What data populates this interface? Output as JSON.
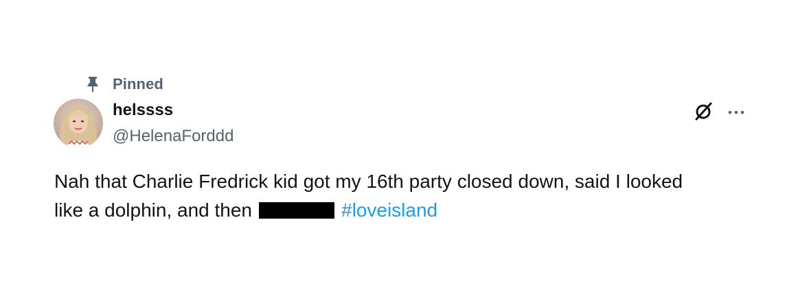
{
  "pinned": {
    "label": "Pinned",
    "icon": "pin-icon"
  },
  "author": {
    "display_name": "helssss",
    "handle": "@HelenaForddd",
    "avatar_icon": "avatar"
  },
  "actions": {
    "grok_icon": "grok-icon",
    "more_icon": "more-icon"
  },
  "tweet": {
    "text": "Nah that Charlie Fredrick kid got my 16th party closed down, said I looked like a dolphin, and then",
    "hashtag": "#loveisland"
  },
  "colors": {
    "primary_text": "#0f1419",
    "secondary_text": "#536471",
    "link": "#1d9bf0",
    "redaction": "#000000"
  }
}
